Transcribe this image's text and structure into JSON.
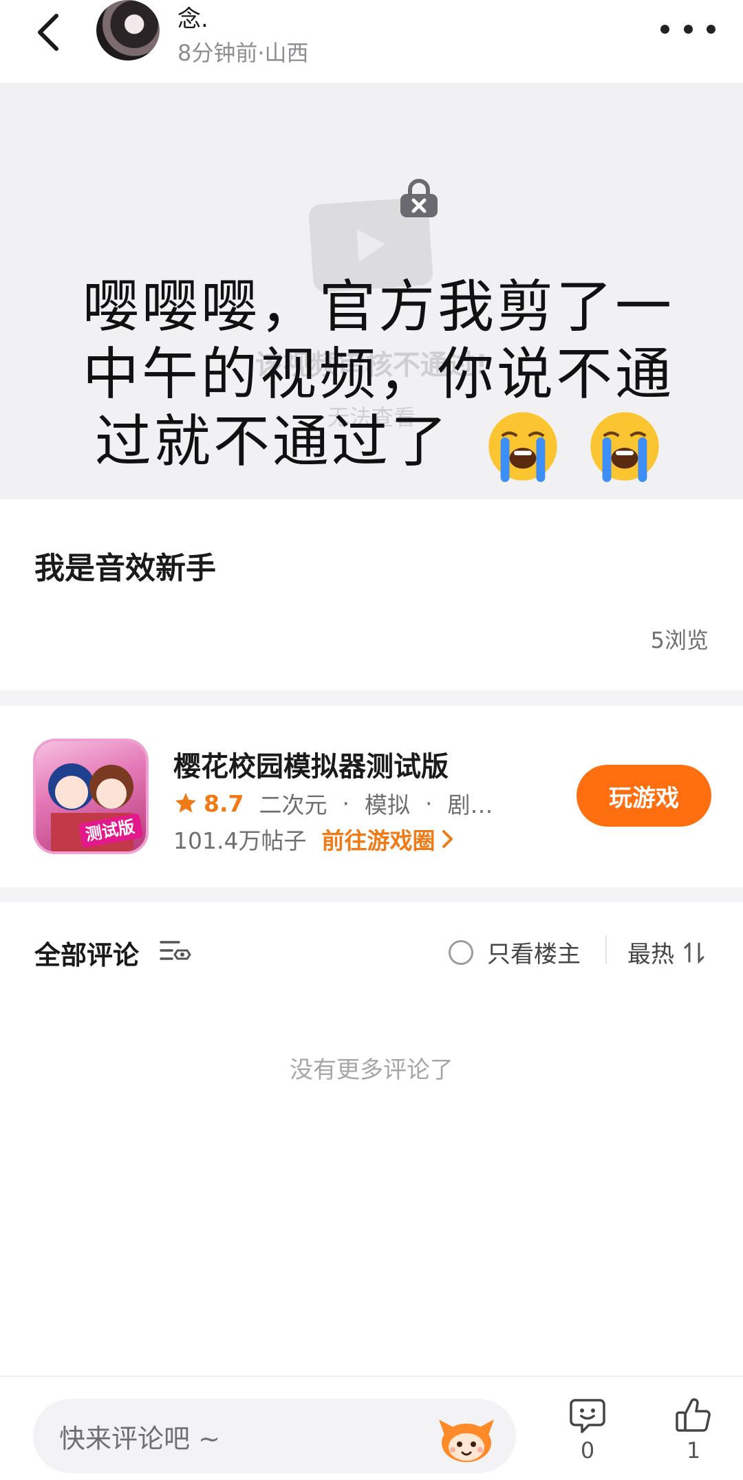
{
  "header": {
    "back_icon": "chevron-left-icon",
    "username": "念.",
    "meta": "8分钟前·山西",
    "more_icon": "more-dots-icon"
  },
  "video": {
    "blocked_title": "该视频审核不通过!",
    "blocked_sub": "无法查看",
    "overlay_lines": [
      "嘤嘤嘤，官方我剪了一",
      "中午的视频，你说不通",
      "过就不通过了"
    ],
    "emoji": "loudly-crying-face"
  },
  "post": {
    "title": "我是音效新手",
    "views": "5浏览"
  },
  "game": {
    "name": "樱花校园模拟器测试版",
    "icon_badge": "测试版",
    "rating": "8.7",
    "tags": [
      "二次元",
      "模拟",
      "剧…"
    ],
    "posts": "101.4万帖子",
    "circle_link": "前往游戏圈",
    "play_label": "玩游戏",
    "accent_color": "#ff6f0f"
  },
  "comments": {
    "title": "全部评论",
    "only_op": "只看楼主",
    "sort": "最热",
    "empty": "没有更多评论了"
  },
  "bottom": {
    "input_placeholder": "快来评论吧 ~",
    "comment_count": "0",
    "like_count": "1"
  }
}
